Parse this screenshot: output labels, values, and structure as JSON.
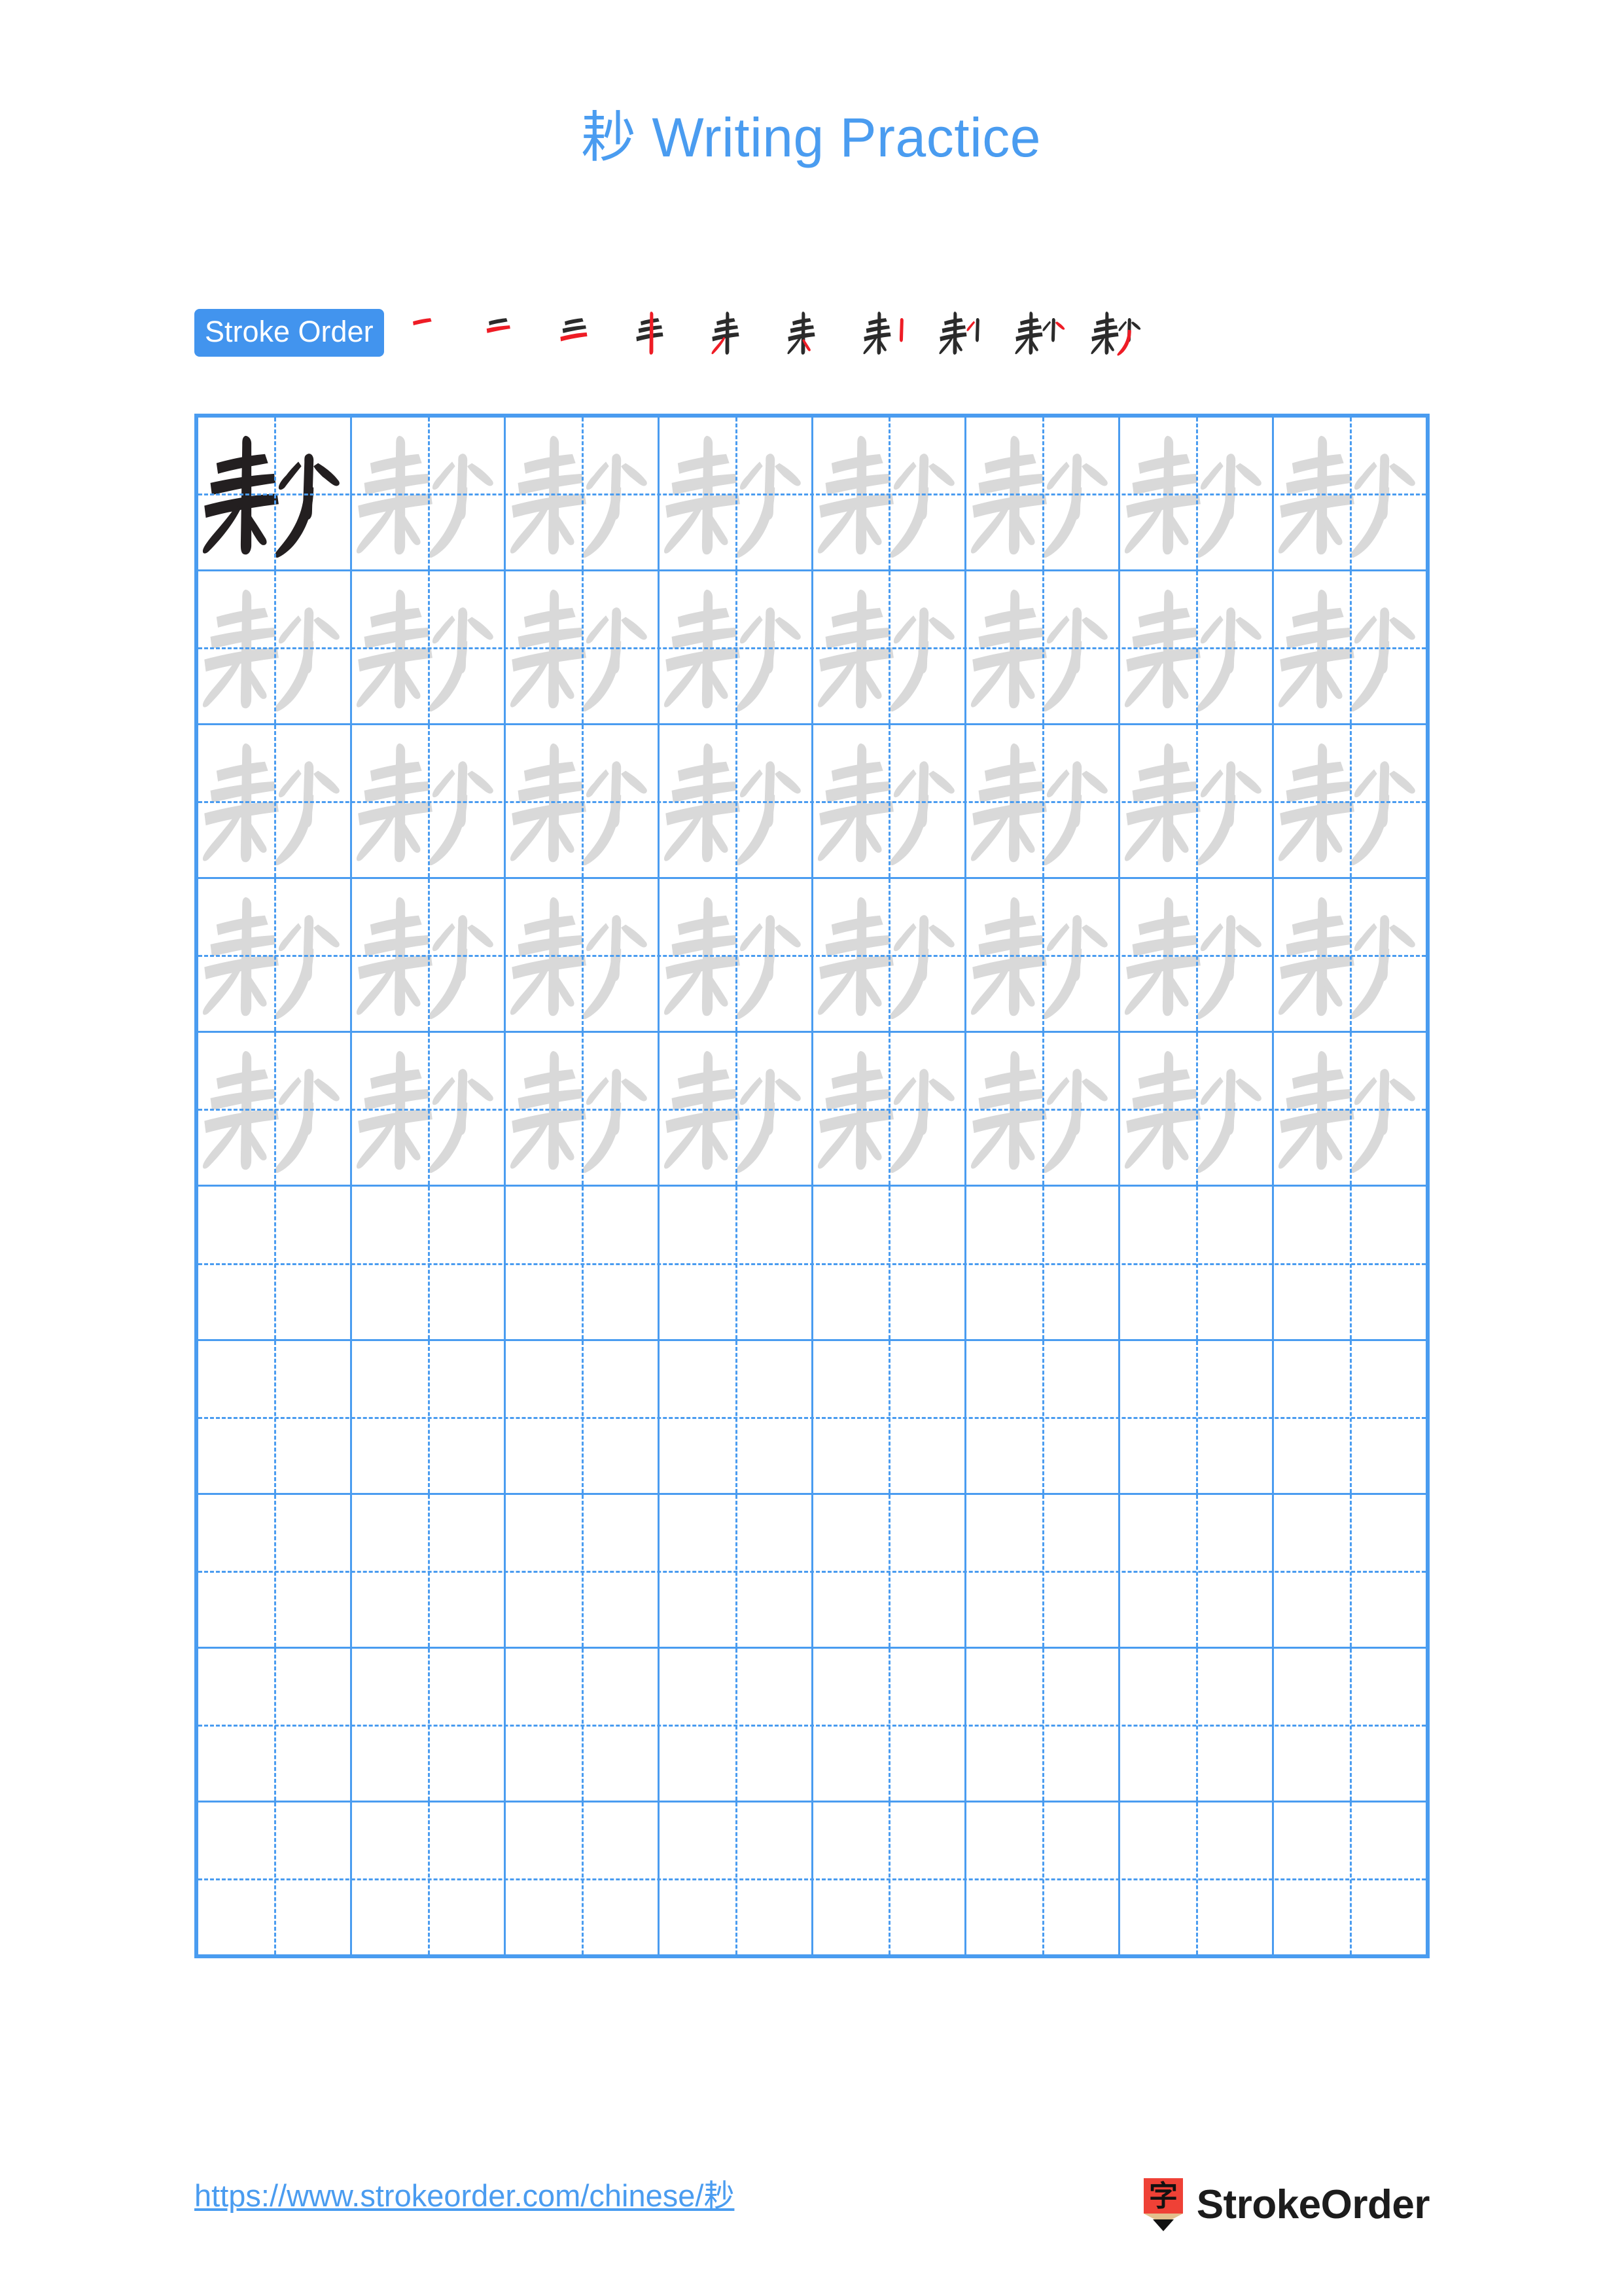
{
  "page": {
    "character": "耖",
    "title": "耖 Writing Practice",
    "title_suffix": "Writing Practice",
    "accent_color": "#4a9cf0",
    "badge_color": "#4294ee",
    "new_stroke_color": "#ee1c25",
    "drawn_stroke_color": "#2b2b2b",
    "trace_stroke_color": "#d9d9d9"
  },
  "stroke_order": {
    "label": "Stroke Order",
    "total_strokes": 10,
    "steps": [
      {
        "index": 1,
        "new_stroke_name": "heng"
      },
      {
        "index": 2,
        "new_stroke_name": "heng"
      },
      {
        "index": 3,
        "new_stroke_name": "heng"
      },
      {
        "index": 4,
        "new_stroke_name": "shu"
      },
      {
        "index": 5,
        "new_stroke_name": "pie"
      },
      {
        "index": 6,
        "new_stroke_name": "dian"
      },
      {
        "index": 7,
        "new_stroke_name": "shu"
      },
      {
        "index": 8,
        "new_stroke_name": "pie"
      },
      {
        "index": 9,
        "new_stroke_name": "dian"
      },
      {
        "index": 10,
        "new_stroke_name": "pie-long"
      }
    ]
  },
  "grid": {
    "columns": 8,
    "rows": 10,
    "cells": [
      [
        "solid",
        "trace",
        "trace",
        "trace",
        "trace",
        "trace",
        "trace",
        "trace"
      ],
      [
        "trace",
        "trace",
        "trace",
        "trace",
        "trace",
        "trace",
        "trace",
        "trace"
      ],
      [
        "trace",
        "trace",
        "trace",
        "trace",
        "trace",
        "trace",
        "trace",
        "trace"
      ],
      [
        "trace",
        "trace",
        "trace",
        "trace",
        "trace",
        "trace",
        "trace",
        "trace"
      ],
      [
        "trace",
        "trace",
        "trace",
        "trace",
        "trace",
        "trace",
        "trace",
        "trace"
      ],
      [
        "empty",
        "empty",
        "empty",
        "empty",
        "empty",
        "empty",
        "empty",
        "empty"
      ],
      [
        "empty",
        "empty",
        "empty",
        "empty",
        "empty",
        "empty",
        "empty",
        "empty"
      ],
      [
        "empty",
        "empty",
        "empty",
        "empty",
        "empty",
        "empty",
        "empty",
        "empty"
      ],
      [
        "empty",
        "empty",
        "empty",
        "empty",
        "empty",
        "empty",
        "empty",
        "empty"
      ],
      [
        "empty",
        "empty",
        "empty",
        "empty",
        "empty",
        "empty",
        "empty",
        "empty"
      ]
    ]
  },
  "footer": {
    "url": "https://www.strokeorder.com/chinese/耖",
    "brand_name": "StrokeOrder",
    "brand_mark_character": "字",
    "brand_mark_body_color": "#ef4136",
    "brand_mark_wood_color": "#e3c08d",
    "brand_mark_tip_color": "#111111"
  }
}
